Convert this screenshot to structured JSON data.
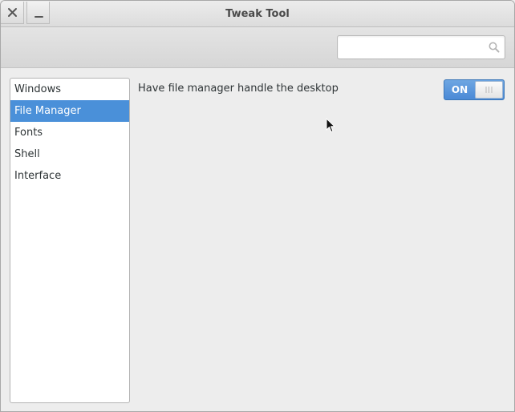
{
  "window": {
    "title": "Tweak Tool"
  },
  "search": {
    "value": "",
    "placeholder": ""
  },
  "sidebar": {
    "items": [
      {
        "label": "Windows",
        "selected": false
      },
      {
        "label": "File Manager",
        "selected": true
      },
      {
        "label": "Fonts",
        "selected": false
      },
      {
        "label": "Shell",
        "selected": false
      },
      {
        "label": "Interface",
        "selected": false
      }
    ]
  },
  "settings": {
    "desktop_toggle": {
      "label": "Have file manager handle the desktop",
      "state_label": "ON",
      "on": true
    }
  },
  "icons": {
    "close": "close-icon",
    "minimize": "minimize-icon",
    "search": "search-icon",
    "cursor": "mouse-pointer-icon"
  },
  "colors": {
    "accent": "#4a90d9",
    "background": "#ededed"
  }
}
